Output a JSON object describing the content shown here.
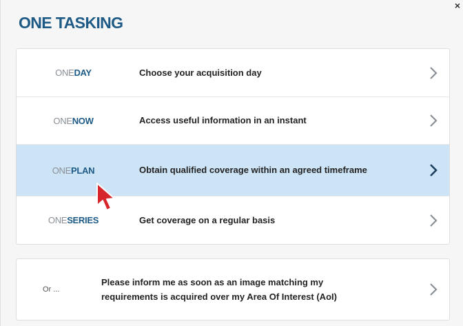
{
  "dialog": {
    "title": "ONE TASKING",
    "close_label": "×"
  },
  "options": [
    {
      "brand_prefix": "ONE",
      "brand_name": "DAY",
      "description": "Choose your acquisition day"
    },
    {
      "brand_prefix": "ONE",
      "brand_name": "NOW",
      "description": "Access useful information in an instant"
    },
    {
      "brand_prefix": "ONE",
      "brand_name": "PLAN",
      "description": "Obtain qualified coverage within an agreed timeframe"
    },
    {
      "brand_prefix": "ONE",
      "brand_name": "SERIES",
      "description": "Get coverage on a regular basis"
    }
  ],
  "aoi_option": {
    "prefix": "Or ...",
    "description": "Please inform me as soon as an image matching my requirements is acquired over my Area Of Interest (AoI)"
  },
  "colors": {
    "brand": "#1d5a85",
    "highlight": "#cde3f6",
    "cursor": "#d6262b"
  },
  "icons": {
    "row_arrow": "chevron-right-icon",
    "pointer": "mouse-cursor-icon"
  }
}
